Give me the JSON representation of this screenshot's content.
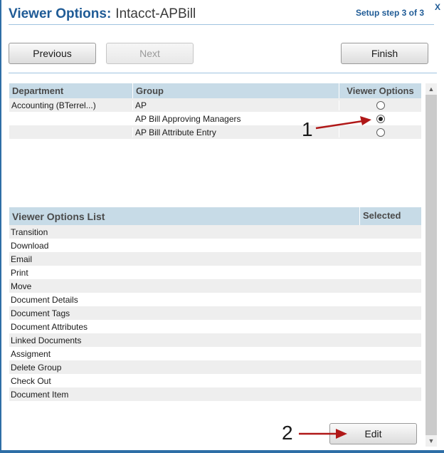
{
  "header": {
    "title_prefix": "Viewer Options:",
    "title_name": "Intacct-APBill",
    "step_label": "Setup step 3 of 3",
    "close_label": "X"
  },
  "nav": {
    "previous_label": "Previous",
    "next_label": "Next",
    "finish_label": "Finish"
  },
  "group_table": {
    "columns": [
      "Department",
      "Group",
      "Viewer Options"
    ],
    "rows": [
      {
        "department": "Accounting (BTerrel...)",
        "group": "AP",
        "selected": false
      },
      {
        "department": "",
        "group": "AP Bill Approving Managers",
        "selected": true
      },
      {
        "department": "",
        "group": "AP Bill Attribute Entry",
        "selected": false
      }
    ]
  },
  "options_table": {
    "columns": [
      "Viewer Options List",
      "Selected"
    ],
    "items": [
      "Transition",
      "Download",
      "Email",
      "Print",
      "Move",
      "Document Details",
      "Document Tags",
      "Document Attributes",
      "Linked Documents",
      "Assigment",
      "Delete Group",
      "Check Out",
      "Document Item"
    ]
  },
  "footer": {
    "edit_label": "Edit"
  },
  "annotations": {
    "marker_1": "1",
    "marker_2": "2",
    "arrow_color": "#b01818"
  },
  "colors": {
    "accent": "#1f5b96",
    "header_bg": "#c7dbe7",
    "stripe": "#eeeeee"
  }
}
